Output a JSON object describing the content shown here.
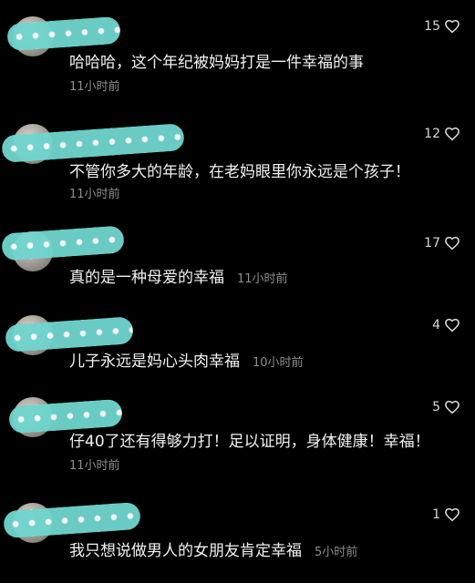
{
  "comments": [
    {
      "username": "",
      "text": "哈哈哈，这个年纪被妈妈打是一件幸福的事",
      "time": "11小时前",
      "likes": "15"
    },
    {
      "username": "",
      "text": "不管你多大的年龄，在老妈眼里你永远是个孩子！",
      "time": "11小时前",
      "likes": "12"
    },
    {
      "username": "",
      "text": "真的是一种母爱的幸福",
      "time": "11小时前",
      "likes": "17"
    },
    {
      "username": "",
      "text": "儿子永远是妈心头肉幸福",
      "time": "10小时前",
      "likes": "4"
    },
    {
      "username": "",
      "text": "仔40了还有得够力打！足以证明，身体健康！幸福！",
      "time": "11小时前",
      "likes": "5"
    },
    {
      "username": "",
      "text": "我只想说做男人的女朋友肯定幸福",
      "time": "5小时前",
      "likes": "1"
    }
  ],
  "colors": {
    "background": "#000000",
    "text": "#f2f2f2",
    "meta": "#8e8e8e",
    "redact": "#6fd6cf"
  },
  "icons": {
    "like": "heart-outline-icon"
  }
}
